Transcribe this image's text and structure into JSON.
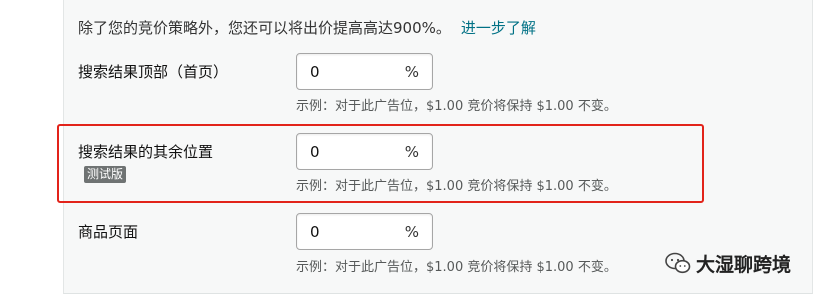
{
  "intro": {
    "text": "除了您的竞价策略外，您还可以将出价提高高达900%。",
    "link": "进一步了解"
  },
  "rows": [
    {
      "label": "搜索结果顶部（首页）",
      "value": "0",
      "unit": "%",
      "hint": "示例：对于此广告位，$1.00 竞价将保持 $1.00 不变。"
    },
    {
      "label": "搜索结果的其余位置",
      "badge": "测试版",
      "value": "0",
      "unit": "%",
      "hint": "示例：对于此广告位，$1.00 竞价将保持 $1.00 不变。"
    },
    {
      "label": "商品页面",
      "value": "0",
      "unit": "%",
      "hint": "示例：对于此广告位，$1.00 竞价将保持 $1.00 不变。"
    }
  ],
  "watermark": {
    "text": "大湿聊跨境",
    "icon": "wechat-icon"
  },
  "colors": {
    "link": "#007185",
    "highlight": "#e2231a",
    "badge": "#6f7373"
  }
}
